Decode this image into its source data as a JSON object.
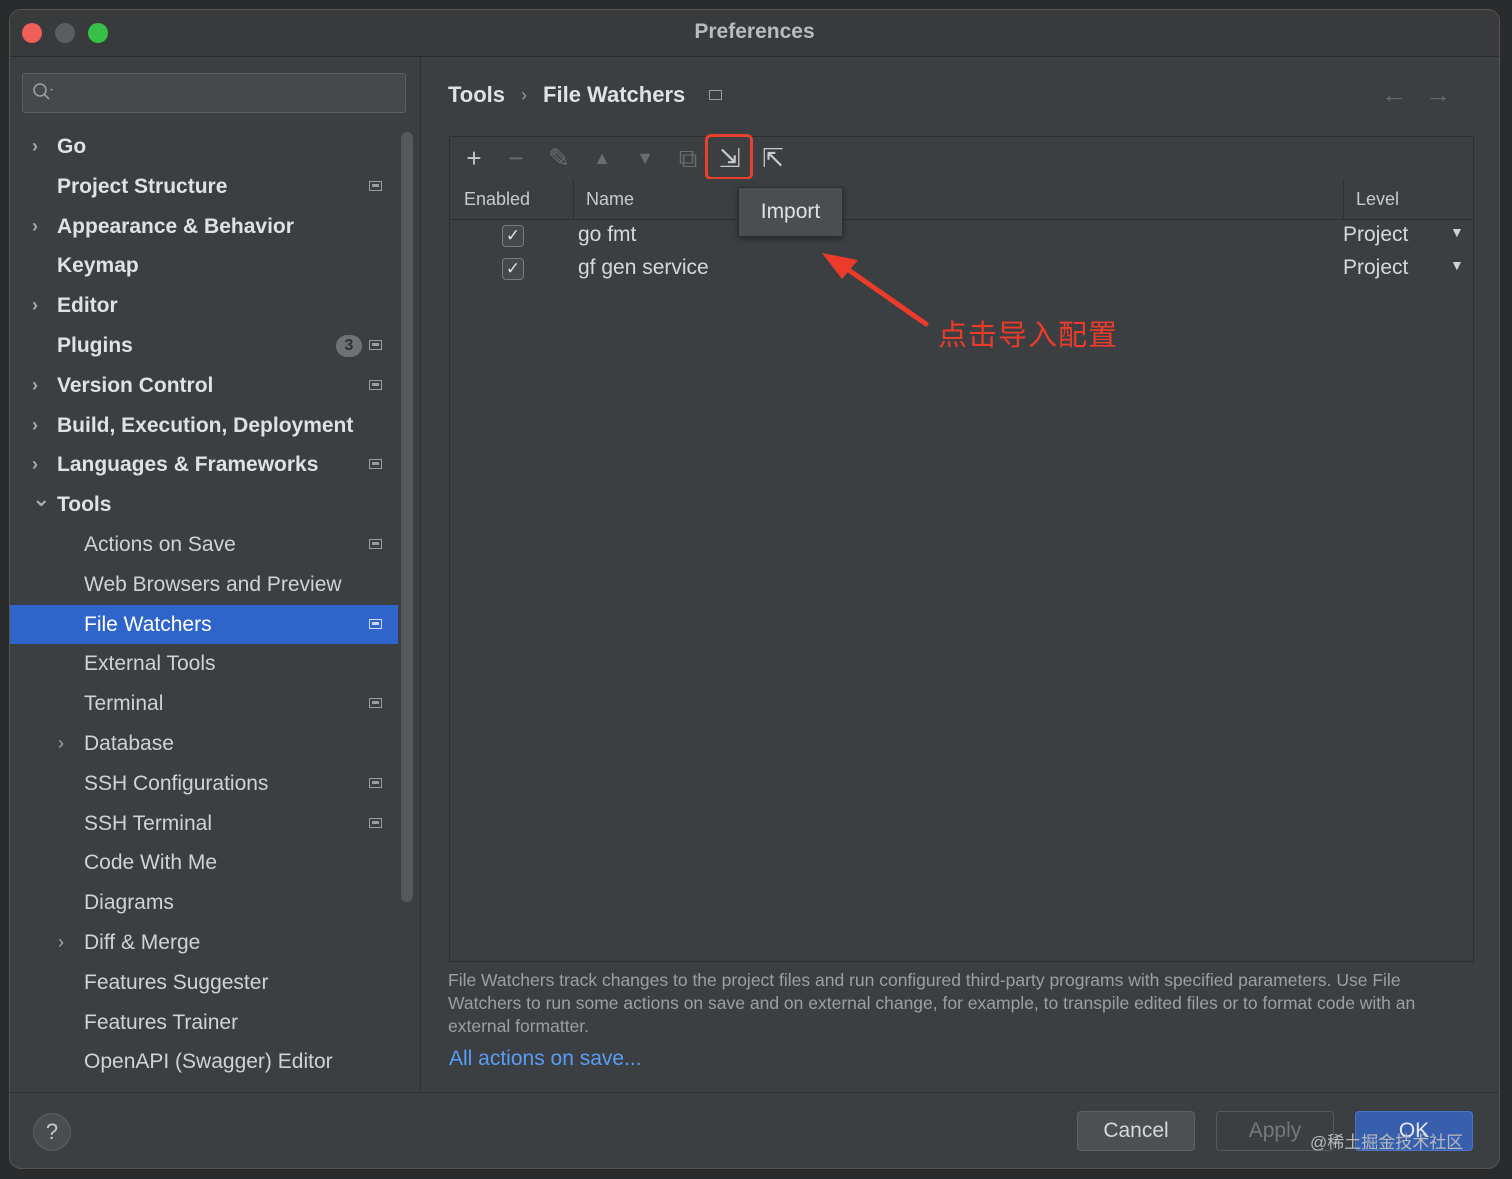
{
  "window": {
    "title": "Preferences"
  },
  "sidebar": {
    "search": {
      "placeholder": ""
    },
    "items": [
      {
        "label": "Go",
        "level": 0,
        "chevron": "right",
        "bold": true
      },
      {
        "label": "Project Structure",
        "level": 0,
        "bold": true,
        "project_icon": true
      },
      {
        "label": "Appearance & Behavior",
        "level": 0,
        "chevron": "right",
        "bold": true
      },
      {
        "label": "Keymap",
        "level": 0,
        "bold": true
      },
      {
        "label": "Editor",
        "level": 0,
        "chevron": "right",
        "bold": true
      },
      {
        "label": "Plugins",
        "level": 0,
        "bold": true,
        "badge": "3",
        "project_icon": true
      },
      {
        "label": "Version Control",
        "level": 0,
        "chevron": "right",
        "bold": true,
        "project_icon": true
      },
      {
        "label": "Build, Execution, Deployment",
        "level": 0,
        "chevron": "right",
        "bold": true
      },
      {
        "label": "Languages & Frameworks",
        "level": 0,
        "chevron": "right",
        "bold": true,
        "project_icon": true
      },
      {
        "label": "Tools",
        "level": 0,
        "chevron": "down",
        "bold": true
      },
      {
        "label": "Actions on Save",
        "level": 1,
        "project_icon": true
      },
      {
        "label": "Web Browsers and Preview",
        "level": 1
      },
      {
        "label": "File Watchers",
        "level": 1,
        "project_icon": true,
        "selected": true
      },
      {
        "label": "External Tools",
        "level": 1
      },
      {
        "label": "Terminal",
        "level": 1,
        "project_icon": true
      },
      {
        "label": "Database",
        "level": 1,
        "chevron": "right"
      },
      {
        "label": "SSH Configurations",
        "level": 1,
        "project_icon": true
      },
      {
        "label": "SSH Terminal",
        "level": 1,
        "project_icon": true
      },
      {
        "label": "Code With Me",
        "level": 1
      },
      {
        "label": "Diagrams",
        "level": 1
      },
      {
        "label": "Diff & Merge",
        "level": 1,
        "chevron": "right"
      },
      {
        "label": "Features Suggester",
        "level": 1
      },
      {
        "label": "Features Trainer",
        "level": 1
      },
      {
        "label": "OpenAPI (Swagger) Editor",
        "level": 1
      }
    ]
  },
  "content": {
    "breadcrumb": {
      "parent": "Tools",
      "sep": "›",
      "current": "File Watchers"
    },
    "nav": {
      "back": "←",
      "forward": "→"
    },
    "toolbar": {
      "add": "+",
      "remove": "−",
      "edit": "✎",
      "up": "▲",
      "down": "▼",
      "copy": "⧉",
      "import": "⇲",
      "export": "⇱",
      "tooltip": "Import"
    },
    "table": {
      "columns": [
        "Enabled",
        "Name",
        "Level"
      ],
      "rows": [
        {
          "enabled": true,
          "name": "go fmt",
          "level": "Project"
        },
        {
          "enabled": true,
          "name": "gf gen service",
          "level": "Project"
        }
      ]
    },
    "annotation": "点击导入配置",
    "description": "File Watchers track changes to the project files and run configured third-party programs with specified parameters. Use File Watchers to run some actions on save and on external change, for example, to transpile edited files or to format code with an external formatter.",
    "link": "All actions on save..."
  },
  "buttons": {
    "help": "?",
    "cancel": "Cancel",
    "apply": "Apply",
    "ok": "OK"
  },
  "watermark": "@稀土掘金技术社区",
  "colors": {
    "accent": "#2f65ca",
    "annotation": "#ec3b2a",
    "link": "#589df6"
  }
}
